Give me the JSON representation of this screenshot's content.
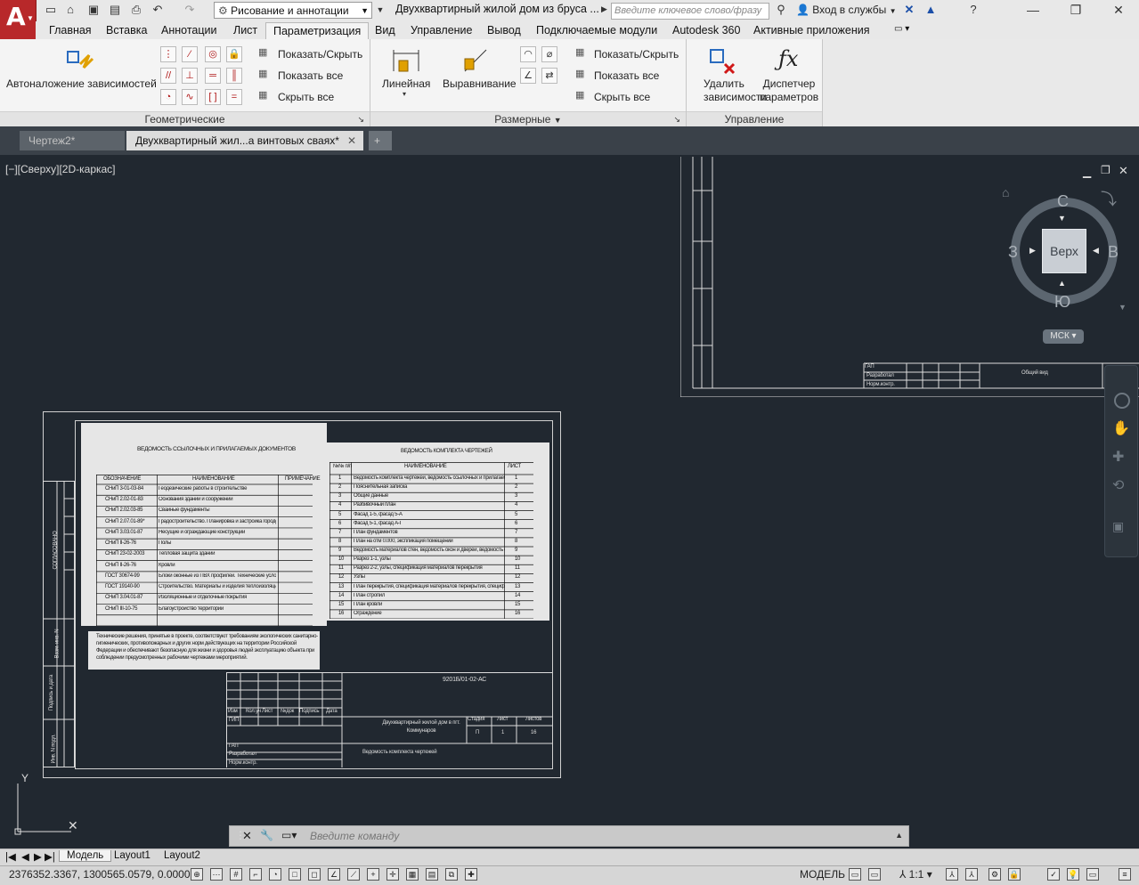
{
  "app": {
    "logo": "A"
  },
  "quick_access": {
    "icons": [
      "new-icon",
      "open-icon",
      "save-icon",
      "saveas-icon",
      "print-icon",
      "undo-icon",
      "redo-icon"
    ],
    "workspace": "Рисование и аннотации"
  },
  "title": "Двухквартирный жилой дом из бруса ...",
  "search": {
    "placeholder": "Введите ключевое слово/фразу"
  },
  "signin": "Вход в службы",
  "ribbon_tabs": [
    "Главная",
    "Вставка",
    "Аннотации",
    "Лист",
    "Параметризация",
    "Вид",
    "Управление",
    "Вывод",
    "Подключаемые модули",
    "Autodesk 360",
    "Активные приложения"
  ],
  "ribbon": {
    "auto_constrain": "Автоналожение зависимостей",
    "geo_show_hide": "Показать/Скрыть",
    "geo_show_all": "Показать все",
    "geo_hide_all": "Скрыть все",
    "panel_geometric": "Геометрические",
    "linear": "Линейная",
    "aligned": "Выравнивание",
    "dim_show_hide": "Показать/Скрыть",
    "dim_show_all": "Показать все",
    "dim_hide_all": "Скрыть все",
    "panel_dimensional": "Размерные",
    "delete_constraints": "Удалить зависимости",
    "param_manager": "Диспетчер параметров",
    "panel_manage": "Управление"
  },
  "doc_tabs": [
    "Чертеж2*",
    "Двухквартирный жил...а винтовых сваях*"
  ],
  "viewport_label": "[−][Сверху][2D-каркас]",
  "viewcube": {
    "top": "Верх",
    "north": "С",
    "south": "Ю",
    "west": "З",
    "east": "В",
    "wcs": "МСК"
  },
  "drawing": {
    "vedomost_refs_title": "ВЕДОМОСТЬ ССЫЛОЧНЫХ И ПРИЛАГАЕМЫХ ДОКУМЕНТОВ",
    "refs_headers": [
      "ОБОЗНАЧЕНИЕ",
      "НАИМЕНОВАНИЕ",
      "ПРИМЕЧАНИЕ"
    ],
    "refs_rows": [
      [
        "СНиП 3-01-03-84",
        "Геодезические работы в строительстве"
      ],
      [
        "СНиП 2.02-01-83",
        "Основания зданий и сооружений"
      ],
      [
        "СНиП 2.02.03-85",
        "Свайные фундаменты"
      ],
      [
        "СНиП 2.07.01-89*",
        "Градостроительство. Планировка и застройка городских и сельских поселений"
      ],
      [
        "СНиП 3.03.01-87",
        "Несущие и ограждающие конструкции"
      ],
      [
        "СНиП II-26-76",
        "Полы"
      ],
      [
        "СНиП 23-02-2003",
        "Тепловая защита зданий"
      ],
      [
        "СНиП II-26-76",
        "Кровли"
      ],
      [
        "ГОСТ 30674-99",
        "Блоки оконные из ПВХ профилей. Технические условия."
      ],
      [
        "ГОСТ 19140-90",
        "Строительство. Материалы и изделия теплоизоляционные"
      ],
      [
        "СНиП 3.04.01-87",
        "Изоляционные и отделочные покрытия"
      ],
      [
        "СНиП III-10-75",
        "Благоустройство территории"
      ]
    ],
    "note_text": "Технические решения, принятые в проекте, соответствуют требованиям экологических санитарно-гигиенических, противопожарных и других норм действующих на территории Российской Федерации и обеспечивают безопасную для жизни и здоровья людей эксплуатацию объекта при соблюдении предусмотренных рабочими чертежами мероприятий.",
    "vedomost_drawings_title": "ВЕДОМОСТЬ КОМПЛЕКТА ЧЕРТЕЖЕЙ",
    "drawings_headers": [
      "№№ п/п",
      "НАИМЕНОВАНИЕ",
      "ЛИСТ"
    ],
    "drawings_rows": [
      [
        "1",
        "Ведомость комплекта чертежей, ведомость ссылочных и прилагаемых документов",
        "1"
      ],
      [
        "2",
        "Пояснительная записка",
        "2"
      ],
      [
        "3",
        "Общие данные",
        "3"
      ],
      [
        "4",
        "Разбивочный план",
        "4"
      ],
      [
        "5",
        "Фасад 1-5, фасад 5-А",
        "5"
      ],
      [
        "6",
        "Фасад 5-1, фасад А-Г",
        "6"
      ],
      [
        "7",
        "План фундаментов",
        "7"
      ],
      [
        "8",
        "План на отм 0.000, экспликация помещений",
        "8"
      ],
      [
        "9",
        "Ведомость материалов стен, ведомость окон и дверей, ведомость отделки помещений, экспликация полов",
        "9"
      ],
      [
        "10",
        "Разрез 1-1, узлы",
        "10"
      ],
      [
        "11",
        "Разрез 2-2, узлы, спецификация материалов перекрытия",
        "11"
      ],
      [
        "12",
        "Узлы",
        "12"
      ],
      [
        "13",
        "План перекрытия, спецификация материалов перекрытия, спецификация материалов кровли",
        "13"
      ],
      [
        "14",
        "План стропил",
        "14"
      ],
      [
        "15",
        "План кровли",
        "15"
      ],
      [
        "16",
        "Ограждение",
        "16"
      ]
    ],
    "stamp": {
      "code": "9201Б/01-02-АС",
      "col_headers": [
        "Изм",
        "Кол.уч",
        "Лист",
        "№док",
        "Подпись",
        "Дата"
      ],
      "roles": [
        "ГИП",
        "ГАП",
        "Разработал",
        "Норм.контр."
      ],
      "object": "Двухквартирный жилой дом в пгт. Коммунаров",
      "sheet_title": "Ведомость комплекта чертежей",
      "stage_label": "Стадия",
      "sheet_label": "Лист",
      "sheets_label": "Листов",
      "stage": "П",
      "sheet": "1",
      "sheets": "16"
    },
    "side_labels": [
      "СОГЛАСОВАНО",
      "Взам. инв. N",
      "Подпись и дата",
      "Инв. N подл."
    ],
    "right_stamp": {
      "roles": [
        "ГАП",
        "Разработал",
        "Норм.контр."
      ],
      "title": "Общий вид"
    }
  },
  "command_line": {
    "placeholder": "Введите команду"
  },
  "layout_tabs": [
    "Модель",
    "Layout1",
    "Layout2"
  ],
  "status": {
    "coords": "2376352.3367, 1300565.0579, 0.0000",
    "model": "МОДЕЛЬ",
    "scale": "1:1"
  },
  "colors": {
    "canvas": "#212830",
    "accent": "#b8282a",
    "ribbon": "#f4f4f4"
  }
}
